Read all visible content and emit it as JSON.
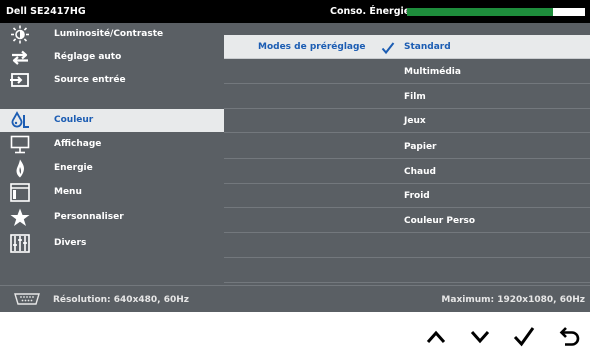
{
  "title_bar": {
    "model": "Dell SE2417HG",
    "energy_label": "Conso. Énergie",
    "energy_level": 0.82,
    "energy_color": "#1e8d3c"
  },
  "sidebar": {
    "items": [
      {
        "label": "Luminosité/Contraste",
        "icon": "brightness-icon"
      },
      {
        "label": "Réglage auto",
        "icon": "auto-adjust-icon"
      },
      {
        "label": "Source entrée",
        "icon": "input-source-icon"
      },
      {
        "label": "Couleur",
        "icon": "color-icon",
        "selected": true
      },
      {
        "label": "Affichage",
        "icon": "display-icon"
      },
      {
        "label": "Energie",
        "icon": "energy-icon"
      },
      {
        "label": "Menu",
        "icon": "menu-icon"
      },
      {
        "label": "Personnaliser",
        "icon": "star-icon"
      },
      {
        "label": "Divers",
        "icon": "sliders-icon"
      }
    ]
  },
  "main": {
    "category_label": "Modes de préréglage",
    "selected_value": "Standard",
    "options": [
      "Standard",
      "Multimédia",
      "Film",
      "Jeux",
      "Papier",
      "Chaud",
      "Froid",
      "Couleur Perso"
    ]
  },
  "status_bar": {
    "connector_icon": "vga-connector-icon",
    "resolution": "Résolution: 640x480, 60Hz",
    "maximum": "Maximum: 1920x1080, 60Hz"
  },
  "nav_buttons": [
    {
      "name": "up",
      "icon": "chevron-up-icon"
    },
    {
      "name": "down",
      "icon": "chevron-down-icon"
    },
    {
      "name": "ok",
      "icon": "check-icon"
    },
    {
      "name": "back",
      "icon": "back-arrow-icon"
    }
  ],
  "colors": {
    "osd_background": "#5a5f64",
    "selection_background": "#e8eaeb",
    "accent_blue": "#1c5db3"
  }
}
